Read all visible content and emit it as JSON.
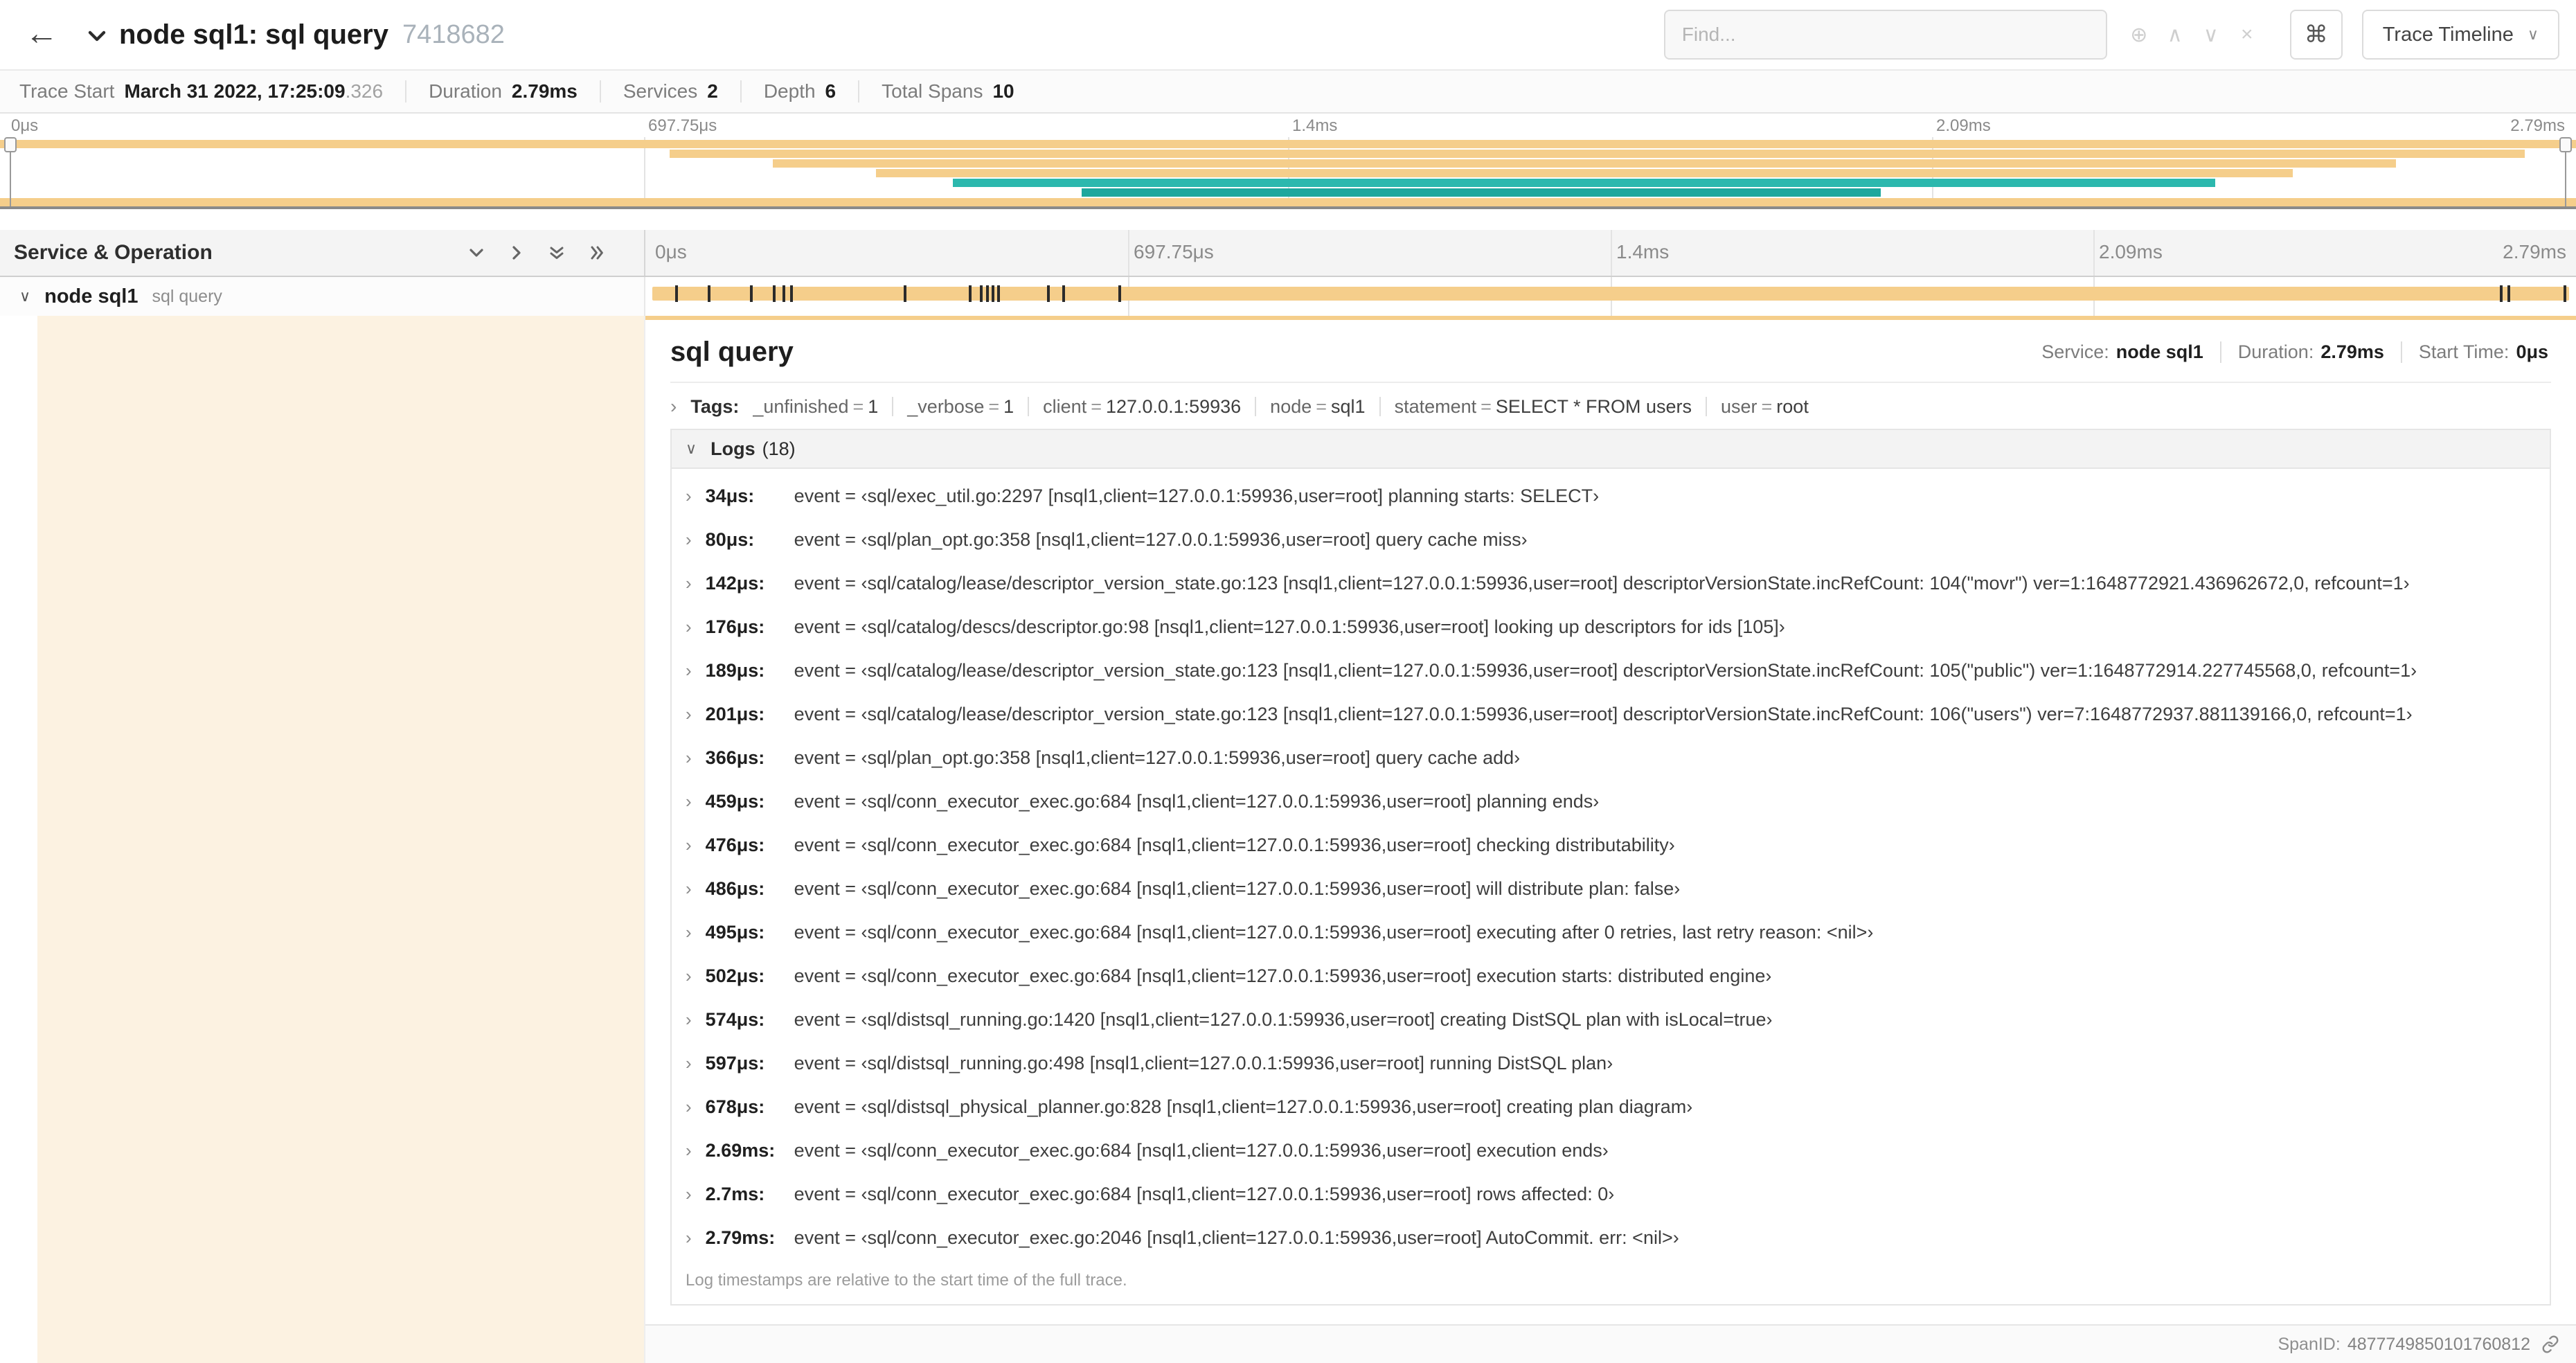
{
  "colors": {
    "span": "#F5CE8B",
    "span_light": "rgba(245,206,139,0.26)",
    "teal": "#2CB8AE",
    "teal_dark": "#1FA79D"
  },
  "header": {
    "back_icon": "←",
    "title": "node sql1: sql query",
    "trace_id": "7418682",
    "find": {
      "placeholder": "Find..."
    },
    "find_icons": {
      "focus": "⊕",
      "prev": "∧",
      "next": "∨",
      "clear": "×"
    },
    "shortcut_icon": "⌘",
    "view_selector": {
      "label": "Trace Timeline",
      "caret": "∨"
    }
  },
  "summary": {
    "items": [
      {
        "label": "Trace Start",
        "value": "March 31 2022, 17:25:09",
        "suffix": ".326"
      },
      {
        "label": "Duration",
        "value": "2.79ms",
        "suffix": ""
      },
      {
        "label": "Services",
        "value": "2",
        "suffix": ""
      },
      {
        "label": "Depth",
        "value": "6",
        "suffix": ""
      },
      {
        "label": "Total Spans",
        "value": "10",
        "suffix": ""
      }
    ]
  },
  "minimap": {
    "ticks": [
      "0μs",
      "697.75μs",
      "1.4ms",
      "2.09ms",
      "2.79ms"
    ],
    "spans": [
      {
        "row": 0,
        "start": 0,
        "width": 100,
        "color": "span"
      },
      {
        "row": 1,
        "start": 26,
        "width": 72,
        "color": "span"
      },
      {
        "row": 2,
        "start": 30,
        "width": 63,
        "color": "span"
      },
      {
        "row": 3,
        "start": 34,
        "width": 55,
        "color": "span"
      },
      {
        "row": 4,
        "start": 37,
        "width": 49,
        "color": "teal"
      },
      {
        "row": 5,
        "start": 42,
        "width": 31,
        "color": "teal_dark"
      },
      {
        "row": 6,
        "start": 0,
        "width": 100,
        "color": "span"
      }
    ]
  },
  "timeline": {
    "left_header": "Service & Operation",
    "ticks": [
      "0μs",
      "697.75μs",
      "1.4ms",
      "2.09ms",
      "2.79ms"
    ],
    "row": {
      "service": "node sql1",
      "operation": "sql query",
      "chevron": "∨"
    },
    "marker_pcts": [
      1.2,
      2.9,
      5.1,
      6.3,
      6.8,
      7.2,
      13.1,
      16.5,
      17.1,
      17.4,
      17.7,
      18.0,
      20.6,
      21.4,
      24.3,
      96.4,
      96.8,
      99.7
    ]
  },
  "detail": {
    "title": "sql query",
    "meta": [
      {
        "label": "Service:",
        "value": "node sql1"
      },
      {
        "label": "Duration:",
        "value": "2.79ms"
      },
      {
        "label": "Start Time:",
        "value": "0μs"
      }
    ],
    "tags_chevron": "›",
    "tags_label": "Tags:",
    "tags": [
      {
        "key": "_unfinished",
        "value": "1"
      },
      {
        "key": "_verbose",
        "value": "1"
      },
      {
        "key": "client",
        "value": "127.0.0.1:59936"
      },
      {
        "key": "node",
        "value": "sql1"
      },
      {
        "key": "statement",
        "value": "SELECT * FROM users"
      },
      {
        "key": "user",
        "value": "root"
      }
    ],
    "logs_chevron": "∨",
    "logs_label": "Logs",
    "logs_count": "(18)",
    "logs": [
      {
        "time": "34μs:",
        "text": "event = ‹sql/exec_util.go:2297 [nsql1,client=127.0.0.1:59936,user=root] planning starts: SELECT›"
      },
      {
        "time": "80μs:",
        "text": "event = ‹sql/plan_opt.go:358 [nsql1,client=127.0.0.1:59936,user=root] query cache miss›"
      },
      {
        "time": "142μs:",
        "text": "event = ‹sql/catalog/lease/descriptor_version_state.go:123 [nsql1,client=127.0.0.1:59936,user=root] descriptorVersionState.incRefCount: 104(\"movr\") ver=1:1648772921.436962672,0, refcount=1›"
      },
      {
        "time": "176μs:",
        "text": "event = ‹sql/catalog/descs/descriptor.go:98 [nsql1,client=127.0.0.1:59936,user=root] looking up descriptors for ids [105]›"
      },
      {
        "time": "189μs:",
        "text": "event = ‹sql/catalog/lease/descriptor_version_state.go:123 [nsql1,client=127.0.0.1:59936,user=root] descriptorVersionState.incRefCount: 105(\"public\") ver=1:1648772914.227745568,0, refcount=1›"
      },
      {
        "time": "201μs:",
        "text": "event = ‹sql/catalog/lease/descriptor_version_state.go:123 [nsql1,client=127.0.0.1:59936,user=root] descriptorVersionState.incRefCount: 106(\"users\") ver=7:1648772937.881139166,0, refcount=1›"
      },
      {
        "time": "366μs:",
        "text": "event = ‹sql/plan_opt.go:358 [nsql1,client=127.0.0.1:59936,user=root] query cache add›"
      },
      {
        "time": "459μs:",
        "text": "event = ‹sql/conn_executor_exec.go:684 [nsql1,client=127.0.0.1:59936,user=root] planning ends›"
      },
      {
        "time": "476μs:",
        "text": "event = ‹sql/conn_executor_exec.go:684 [nsql1,client=127.0.0.1:59936,user=root] checking distributability›"
      },
      {
        "time": "486μs:",
        "text": "event = ‹sql/conn_executor_exec.go:684 [nsql1,client=127.0.0.1:59936,user=root] will distribute plan: false›"
      },
      {
        "time": "495μs:",
        "text": "event = ‹sql/conn_executor_exec.go:684 [nsql1,client=127.0.0.1:59936,user=root] executing after 0 retries, last retry reason: <nil>›"
      },
      {
        "time": "502μs:",
        "text": "event = ‹sql/conn_executor_exec.go:684 [nsql1,client=127.0.0.1:59936,user=root] execution starts: distributed engine›"
      },
      {
        "time": "574μs:",
        "text": "event = ‹sql/distsql_running.go:1420 [nsql1,client=127.0.0.1:59936,user=root] creating DistSQL plan with isLocal=true›"
      },
      {
        "time": "597μs:",
        "text": "event = ‹sql/distsql_running.go:498 [nsql1,client=127.0.0.1:59936,user=root] running DistSQL plan›"
      },
      {
        "time": "678μs:",
        "text": "event = ‹sql/distsql_physical_planner.go:828 [nsql1,client=127.0.0.1:59936,user=root] creating plan diagram›"
      },
      {
        "time": "2.69ms:",
        "text": "event = ‹sql/conn_executor_exec.go:684 [nsql1,client=127.0.0.1:59936,user=root] execution ends›"
      },
      {
        "time": "2.7ms:",
        "text": "event = ‹sql/conn_executor_exec.go:684 [nsql1,client=127.0.0.1:59936,user=root] rows affected: 0›"
      },
      {
        "time": "2.79ms:",
        "text": "event = ‹sql/conn_executor_exec.go:2046 [nsql1,client=127.0.0.1:59936,user=root] AutoCommit. err: <nil>›"
      }
    ],
    "logs_note": "Log timestamps are relative to the start time of the full trace.",
    "footer": {
      "span_id_label": "SpanID:",
      "span_id": "4877749850101760812"
    }
  }
}
